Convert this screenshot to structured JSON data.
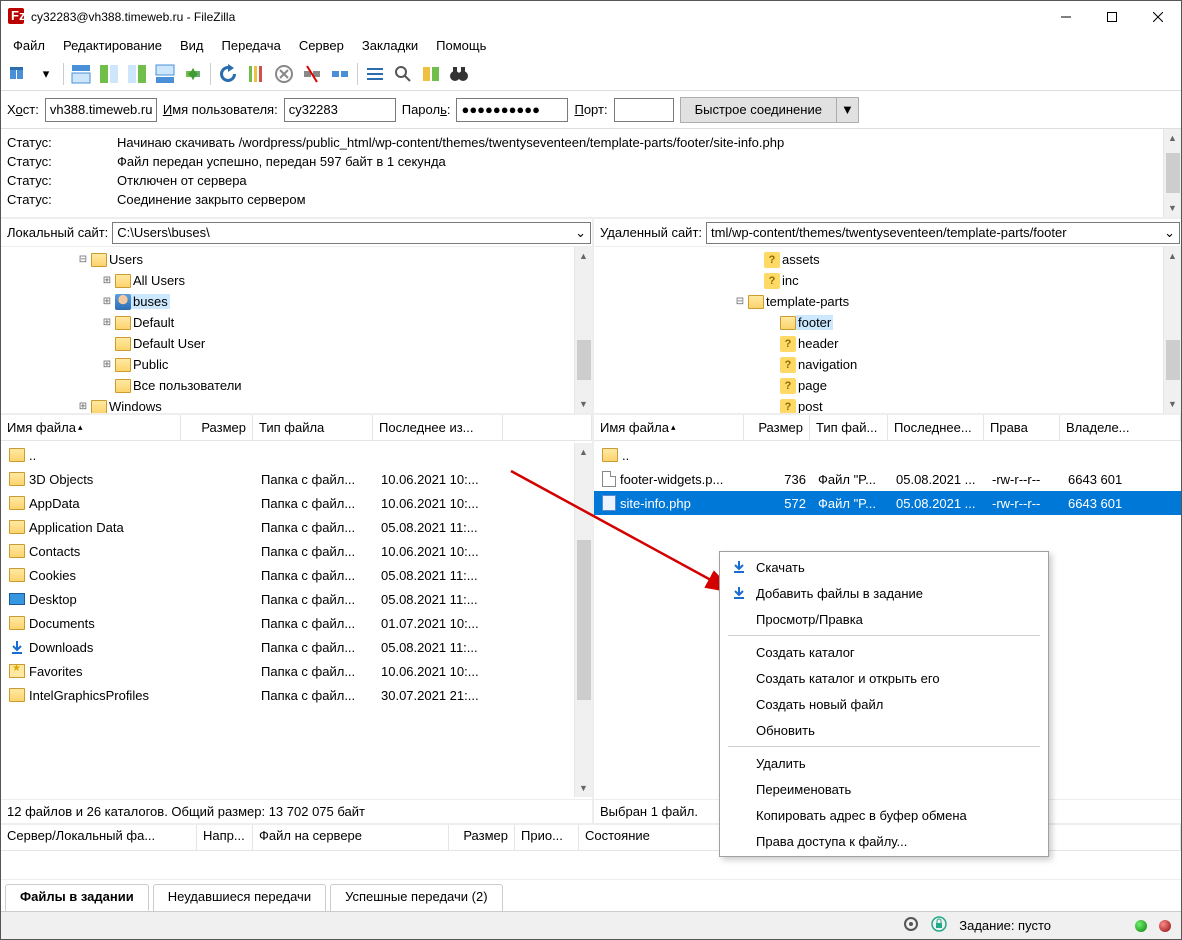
{
  "title": "cy32283@vh388.timeweb.ru - FileZilla",
  "menu": [
    "Файл",
    "Редактирование",
    "Вид",
    "Передача",
    "Сервер",
    "Закладки",
    "Помощь"
  ],
  "qc": {
    "host_label_pre": "Х",
    "host_label_ul": "о",
    "host_label_post": "ст:",
    "host_value": "vh388.timeweb.ru",
    "user_label_pre": "",
    "user_label_ul": "И",
    "user_label_post": "мя пользователя:",
    "user_value": "cy32283",
    "pass_label_pre": "Парол",
    "pass_label_ul": "ь",
    "pass_label_post": ":",
    "pass_value": "●●●●●●●●●●",
    "port_label_pre": "",
    "port_label_ul": "П",
    "port_label_post": "орт:",
    "port_value": "",
    "connect": "Быстрое соединение"
  },
  "log": [
    {
      "lbl": "Статус:",
      "msg": "Начинаю скачивать /wordpress/public_html/wp-content/themes/twentyseventeen/template-parts/footer/site-info.php"
    },
    {
      "lbl": "Статус:",
      "msg": "Файл передан успешно, передан 597 байт в 1 секунда"
    },
    {
      "lbl": "Статус:",
      "msg": "Отключен от сервера"
    },
    {
      "lbl": "Статус:",
      "msg": "Соединение закрыто сервером"
    }
  ],
  "local": {
    "path_label": "Локальный сайт:",
    "path_value": "C:\\Users\\buses\\",
    "tree": [
      {
        "indent": 72,
        "exp": "minus",
        "icon": "folder",
        "label": "Users"
      },
      {
        "indent": 96,
        "exp": "plus",
        "icon": "folder",
        "label": "All Users"
      },
      {
        "indent": 96,
        "exp": "plus",
        "icon": "person",
        "label": "buses",
        "sel": true
      },
      {
        "indent": 96,
        "exp": "plus",
        "icon": "folder",
        "label": "Default"
      },
      {
        "indent": 96,
        "exp": "",
        "icon": "folder",
        "label": "Default User"
      },
      {
        "indent": 96,
        "exp": "plus",
        "icon": "folder",
        "label": "Public"
      },
      {
        "indent": 96,
        "exp": "",
        "icon": "folder",
        "label": "Все пользователи"
      },
      {
        "indent": 72,
        "exp": "plus",
        "icon": "folder",
        "label": "Windows"
      }
    ],
    "cols": [
      "Имя файла",
      "Размер",
      "Тип файла",
      "Последнее из..."
    ],
    "rows": [
      {
        "name": "..",
        "icon": "folder",
        "size": "",
        "type": "",
        "mod": ""
      },
      {
        "name": "3D Objects",
        "icon": "folder3d",
        "size": "",
        "type": "Папка с файл...",
        "mod": "10.06.2021 10:..."
      },
      {
        "name": "AppData",
        "icon": "folder",
        "size": "",
        "type": "Папка с файл...",
        "mod": "10.06.2021 10:..."
      },
      {
        "name": "Application Data",
        "icon": "folder",
        "size": "",
        "type": "Папка с файл...",
        "mod": "05.08.2021 11:..."
      },
      {
        "name": "Contacts",
        "icon": "contacts",
        "size": "",
        "type": "Папка с файл...",
        "mod": "10.06.2021 10:..."
      },
      {
        "name": "Cookies",
        "icon": "folder",
        "size": "",
        "type": "Папка с файл...",
        "mod": "05.08.2021 11:..."
      },
      {
        "name": "Desktop",
        "icon": "desktop",
        "size": "",
        "type": "Папка с файл...",
        "mod": "05.08.2021 11:..."
      },
      {
        "name": "Documents",
        "icon": "folder",
        "size": "",
        "type": "Папка с файл...",
        "mod": "01.07.2021 10:..."
      },
      {
        "name": "Downloads",
        "icon": "download",
        "size": "",
        "type": "Папка с файл...",
        "mod": "05.08.2021 11:..."
      },
      {
        "name": "Favorites",
        "icon": "fav",
        "size": "",
        "type": "Папка с файл...",
        "mod": "10.06.2021 10:..."
      },
      {
        "name": "IntelGraphicsProfiles",
        "icon": "folder",
        "size": "",
        "type": "Папка с файл...",
        "mod": "30.07.2021 21:..."
      }
    ],
    "status": "12 файлов и 26 каталогов. Общий размер: 13 702 075 байт"
  },
  "remote": {
    "path_label": "Удаленный сайт:",
    "path_value": "tml/wp-content/themes/twentyseventeen/template-parts/footer",
    "tree": [
      {
        "indent": 152,
        "exp": "",
        "icon": "q",
        "label": "assets"
      },
      {
        "indent": 152,
        "exp": "",
        "icon": "q",
        "label": "inc"
      },
      {
        "indent": 136,
        "exp": "minus",
        "icon": "folder",
        "label": "template-parts"
      },
      {
        "indent": 168,
        "exp": "",
        "icon": "folder",
        "label": "footer",
        "sel": true
      },
      {
        "indent": 168,
        "exp": "",
        "icon": "q",
        "label": "header"
      },
      {
        "indent": 168,
        "exp": "",
        "icon": "q",
        "label": "navigation"
      },
      {
        "indent": 168,
        "exp": "",
        "icon": "q",
        "label": "page"
      },
      {
        "indent": 168,
        "exp": "",
        "icon": "q",
        "label": "post"
      }
    ],
    "cols": [
      "Имя файла",
      "Размер",
      "Тип фай...",
      "Последнее...",
      "Права",
      "Владеле..."
    ],
    "rows": [
      {
        "name": "..",
        "icon": "folder",
        "size": "",
        "type": "",
        "mod": "",
        "perm": "",
        "own": ""
      },
      {
        "name": "footer-widgets.p...",
        "icon": "file",
        "size": "736",
        "type": "Файл \"P...",
        "mod": "05.08.2021 ...",
        "perm": "-rw-r--r--",
        "own": "6643 601"
      },
      {
        "name": "site-info.php",
        "icon": "php",
        "size": "572",
        "type": "Файл \"P...",
        "mod": "05.08.2021 ...",
        "perm": "-rw-r--r--",
        "own": "6643 601",
        "sel": true
      }
    ],
    "status": "Выбран 1 файл."
  },
  "queue_cols": [
    "Сервер/Локальный фа...",
    "Напр...",
    "Файл на сервере",
    "Размер",
    "Прио...",
    "Состояние"
  ],
  "tabs": [
    "Файлы в задании",
    "Неудавшиеся передачи",
    "Успешные передачи (2)"
  ],
  "statusbar_queue": "Задание: пусто",
  "context": [
    {
      "icon": "dl",
      "label": "Скачать"
    },
    {
      "icon": "dl",
      "label": "Добавить файлы в задание"
    },
    {
      "icon": "",
      "label": "Просмотр/Правка"
    },
    {
      "sep": true
    },
    {
      "icon": "",
      "label": "Создать каталог"
    },
    {
      "icon": "",
      "label": "Создать каталог и открыть его"
    },
    {
      "icon": "",
      "label": "Создать новый файл"
    },
    {
      "icon": "",
      "label": "Обновить"
    },
    {
      "sep": true
    },
    {
      "icon": "",
      "label": "Удалить"
    },
    {
      "icon": "",
      "label": "Переименовать"
    },
    {
      "icon": "",
      "label": "Копировать адрес в буфер обмена"
    },
    {
      "icon": "",
      "label": "Права доступа к файлу..."
    }
  ]
}
